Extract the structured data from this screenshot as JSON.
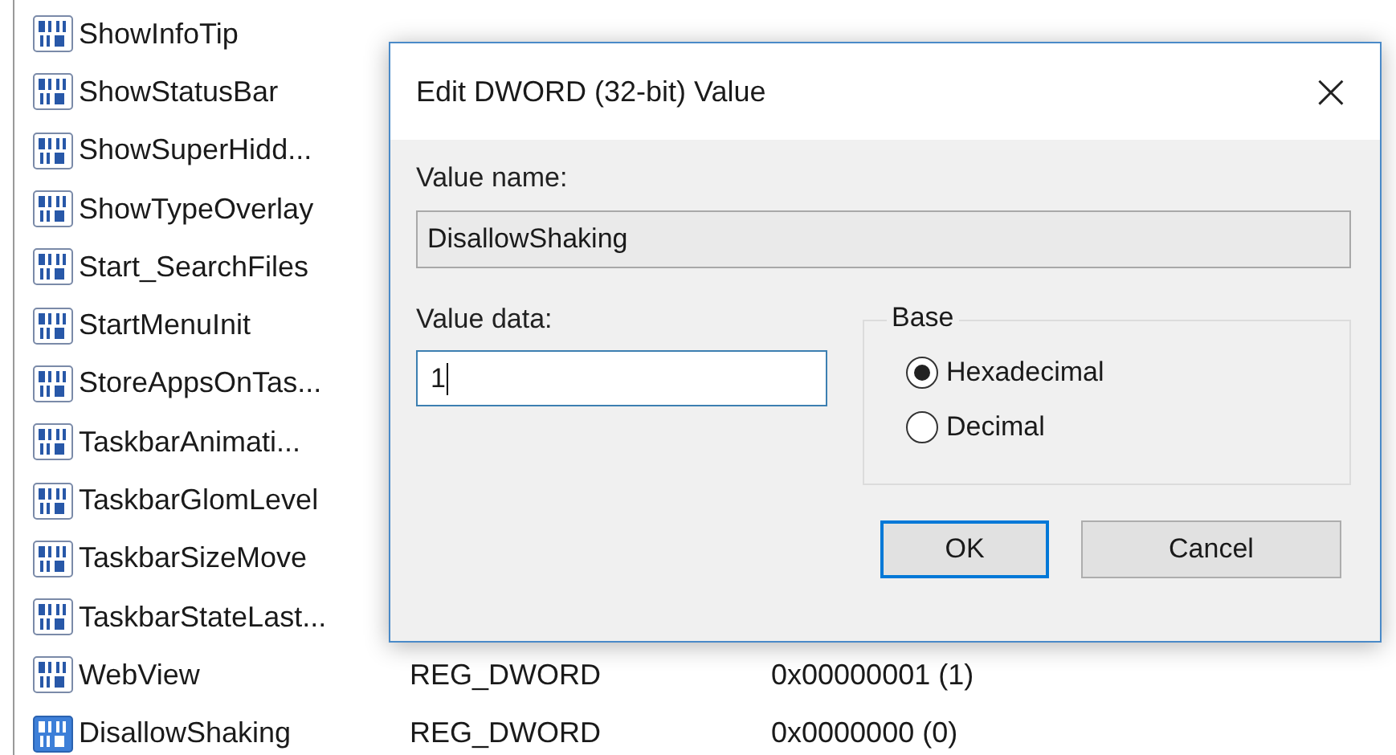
{
  "registry_list": {
    "rows": [
      {
        "name": "ShowInfoTip",
        "selected": false
      },
      {
        "name": "ShowStatusBar",
        "selected": false
      },
      {
        "name": "ShowSuperHidd...",
        "selected": false
      },
      {
        "name": "ShowTypeOverlay",
        "selected": false
      },
      {
        "name": "Start_SearchFiles",
        "selected": false
      },
      {
        "name": "StartMenuInit",
        "selected": false
      },
      {
        "name": "StoreAppsOnTas...",
        "selected": false
      },
      {
        "name": "TaskbarAnimati...",
        "selected": false
      },
      {
        "name": "TaskbarGlomLevel",
        "selected": false
      },
      {
        "name": "TaskbarSizeMove",
        "selected": false
      },
      {
        "name": "TaskbarStateLast...",
        "selected": false
      },
      {
        "name": "WebView",
        "type": "REG_DWORD",
        "data": "0x00000001 (1)",
        "selected": false
      },
      {
        "name": "DisallowShaking",
        "type": "REG_DWORD",
        "data": "0x0000000 (0)",
        "selected": true
      }
    ]
  },
  "dialog": {
    "title": "Edit DWORD (32-bit) Value",
    "close": "×",
    "value_name_label": "Value name:",
    "value_name": "DisallowShaking",
    "value_data_label": "Value data:",
    "value_data": "1",
    "base": {
      "label": "Base",
      "options": [
        {
          "label": "Hexadecimal",
          "selected": true
        },
        {
          "label": "Decimal",
          "selected": false
        }
      ]
    },
    "buttons": [
      {
        "label": "OK",
        "default": true
      },
      {
        "label": "Cancel",
        "default": false
      }
    ]
  }
}
